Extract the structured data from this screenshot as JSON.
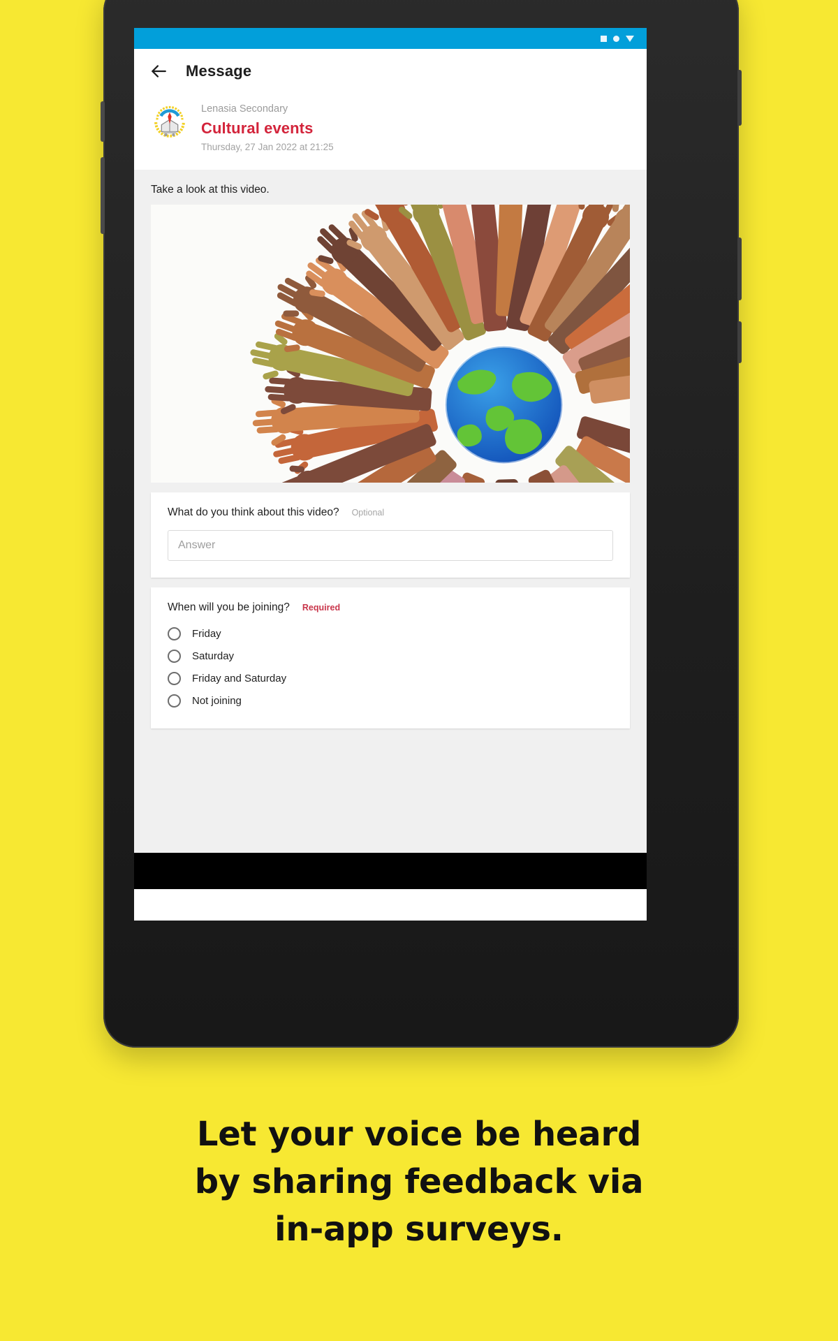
{
  "statusbar": {
    "icons": [
      "square-icon",
      "circle-icon",
      "triangle-down-icon"
    ]
  },
  "appbar": {
    "back_icon": "back-arrow-icon",
    "title": "Message"
  },
  "message": {
    "logo_icon": "school-crest-logo",
    "school": "Lenasia Secondary",
    "subject": "Cultural events",
    "datetime": "Thursday, 27 Jan 2022 at 21:25",
    "subject_color": "#d3243b"
  },
  "content": {
    "intro": "Take a look at this video.",
    "media_icon": "hands-around-globe-image"
  },
  "survey": {
    "question1": {
      "text": "What do you think about this video?",
      "tag": "Optional",
      "answer_value": "",
      "answer_placeholder": "Answer"
    },
    "question2": {
      "text": "When will you be joining?",
      "tag": "Required",
      "options": [
        {
          "label": "Friday",
          "selected": false
        },
        {
          "label": "Saturday",
          "selected": false
        },
        {
          "label": "Friday and Saturday",
          "selected": false
        },
        {
          "label": "Not joining",
          "selected": false
        }
      ]
    }
  },
  "caption": {
    "line1": "Let your voice be heard",
    "line2": "by sharing feedback via",
    "line3": "in-app surveys."
  },
  "colors": {
    "background": "#f7e832",
    "statusbar": "#029fda",
    "accent_red": "#d3243b",
    "device": "#232323"
  }
}
